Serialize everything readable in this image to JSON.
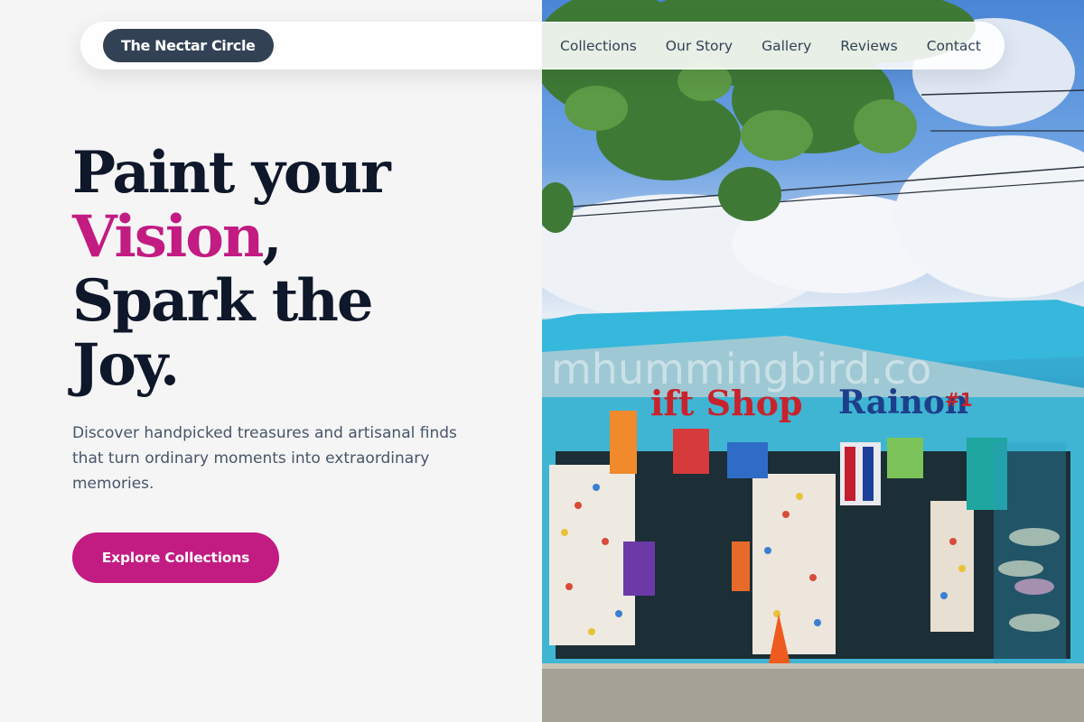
{
  "brand": {
    "name": "The Nectar Circle"
  },
  "nav": {
    "links": [
      "Collections",
      "Our Story",
      "Gallery",
      "Reviews",
      "Contact"
    ]
  },
  "hero": {
    "headline_line1": "Paint your",
    "headline_accent": "Vision",
    "headline_comma": ",",
    "headline_line3": "Spark the",
    "headline_line4": "Joy.",
    "subtitle": "Discover handpicked treasures and artisanal finds that turn ordinary moments into extraordinary memories.",
    "cta_label": "Explore Collections"
  },
  "photo": {
    "sign_left": "ift Shop",
    "sign_right": "Rainon",
    "sign_number": "#1",
    "watermark": "mhummingbird.co"
  },
  "colors": {
    "accent": "#c21b82",
    "brand_bg": "#334155",
    "text_dark": "#0f172a",
    "text_muted": "#475569"
  }
}
